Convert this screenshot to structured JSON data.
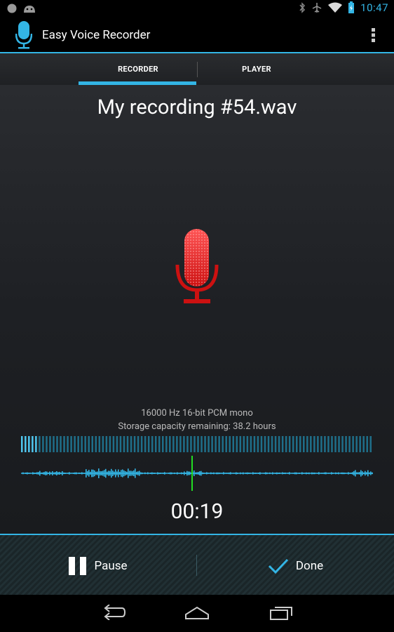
{
  "status": {
    "time": "10:47"
  },
  "actionbar": {
    "title": "Easy Voice Recorder"
  },
  "tabs": [
    {
      "label": "RECORDER",
      "active": true
    },
    {
      "label": "PLAYER",
      "active": false
    }
  ],
  "recording": {
    "filename": "My recording #54.wav",
    "format": "16000 Hz 16-bit PCM mono",
    "storage": "Storage capacity remaining: 38.2 hours",
    "elapsed": "00:19",
    "level": 0.05
  },
  "buttons": {
    "pause_label": "Pause",
    "done_label": "Done"
  },
  "colors": {
    "accent": "#33b5e5",
    "mic_red": "#cc1111",
    "playhead": "#22dd22"
  },
  "icons": [
    "mic-app-icon",
    "overflow-menu-icon",
    "mic-recording-icon",
    "pause-icon",
    "check-icon",
    "back-icon",
    "home-icon",
    "recents-icon",
    "wifi-icon",
    "bluetooth-icon",
    "battery-icon"
  ]
}
